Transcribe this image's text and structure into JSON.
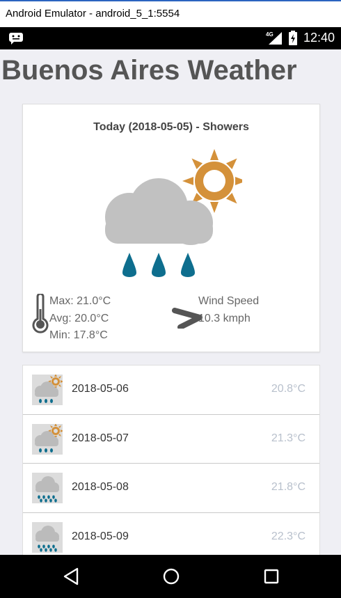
{
  "window": {
    "title": "Android Emulator - android_5_1:5554"
  },
  "status_bar": {
    "network": "4G",
    "time": "12:40"
  },
  "page": {
    "title": "Buenos Aires Weather"
  },
  "today": {
    "heading": "Today (2018-05-05) - Showers",
    "icon": "showers-sun-icon",
    "max": "Max: 21.0°C",
    "avg": "Avg: 20.0°C",
    "min": "Min: 17.8°C",
    "wind_label": "Wind Speed",
    "wind_value": "10.3 kmph"
  },
  "forecast": [
    {
      "date": "2018-05-06",
      "temp": "20.8°C",
      "icon": "showers-sun-icon"
    },
    {
      "date": "2018-05-07",
      "temp": "21.3°C",
      "icon": "showers-sun-icon"
    },
    {
      "date": "2018-05-08",
      "temp": "21.8°C",
      "icon": "heavy-rain-icon"
    },
    {
      "date": "2018-05-09",
      "temp": "22.3°C",
      "icon": "heavy-rain-icon"
    }
  ],
  "colors": {
    "sun": "#d4913a",
    "cloud": "#c1c1c1",
    "rain": "#0e6e8e",
    "temp_text": "#b8c0cc"
  }
}
